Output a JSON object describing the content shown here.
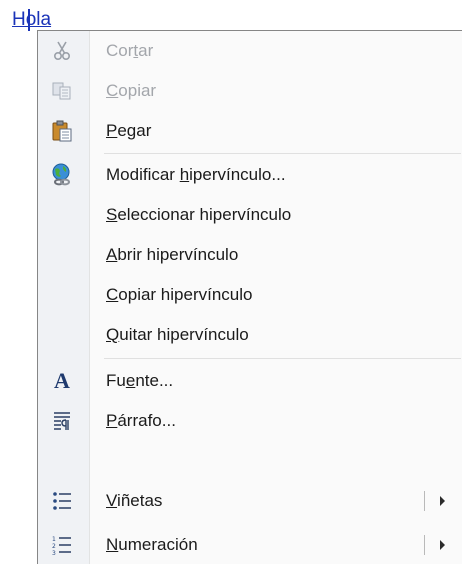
{
  "document": {
    "link_text": "Hola",
    "link_color": "#1a33b8"
  },
  "menu": {
    "items": [
      {
        "id": "cut",
        "prefix": "Cor",
        "accel": "t",
        "suffix": "ar",
        "icon": "scissors-icon",
        "enabled": false
      },
      {
        "id": "copy",
        "prefix": "",
        "accel": "C",
        "suffix": "opiar",
        "icon": "copy-icon",
        "enabled": false
      },
      {
        "id": "paste",
        "prefix": "",
        "accel": "P",
        "suffix": "egar",
        "icon": "paste-icon",
        "enabled": true
      },
      {
        "id": "edit-hyperlink",
        "prefix": "Modificar ",
        "accel": "h",
        "suffix": "ipervínculo...",
        "icon": "hyperlink-globe-icon",
        "enabled": true
      },
      {
        "id": "select-hyperlink",
        "prefix": "",
        "accel": "S",
        "suffix": "eleccionar hipervínculo",
        "icon": "",
        "enabled": true
      },
      {
        "id": "open-hyperlink",
        "prefix": "",
        "accel": "A",
        "suffix": "brir hipervínculo",
        "icon": "",
        "enabled": true
      },
      {
        "id": "copy-hyperlink",
        "prefix": "",
        "accel": "C",
        "suffix": "opiar hipervínculo",
        "icon": "",
        "enabled": true
      },
      {
        "id": "remove-hyperlink",
        "prefix": "",
        "accel": "Q",
        "suffix": "uitar hipervínculo",
        "icon": "",
        "enabled": true
      },
      {
        "id": "font",
        "prefix": "Fu",
        "accel": "e",
        "suffix": "nte...",
        "icon": "font-icon",
        "enabled": true,
        "icon_glyph": "A"
      },
      {
        "id": "paragraph",
        "prefix": "",
        "accel": "P",
        "suffix": "árrafo...",
        "icon": "paragraph-icon",
        "enabled": true
      },
      {
        "id": "bullets",
        "prefix": "",
        "accel": "V",
        "suffix": "iñetas",
        "icon": "bullets-icon",
        "enabled": true,
        "submenu": true
      },
      {
        "id": "numbering",
        "prefix": "",
        "accel": "N",
        "suffix": "umeración",
        "icon": "numbering-icon",
        "enabled": true,
        "submenu": true
      }
    ]
  },
  "colors": {
    "gutter": "#f0f2f5",
    "menu_bg": "#fafafa",
    "disabled_text": "#a3a6ab",
    "text": "#1b1b1b"
  }
}
